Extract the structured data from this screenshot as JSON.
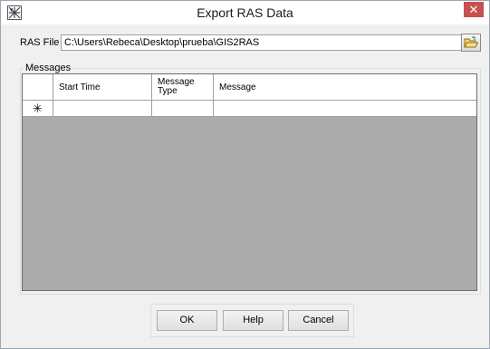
{
  "window": {
    "title": "Export RAS Data",
    "close_label": "✕"
  },
  "file": {
    "label": "RAS File",
    "value": "C:\\Users\\Rebeca\\Desktop\\prueba\\GIS2RAS"
  },
  "messages": {
    "group_label": "Messages",
    "columns": [
      "",
      "Start Time",
      "Message\nType",
      "Message"
    ],
    "new_row_marker": "✳"
  },
  "buttons": {
    "ok": "OK",
    "help": "Help",
    "cancel": "Cancel"
  },
  "icons": {
    "app": "app-logo-icon",
    "browse": "open-folder-icon"
  }
}
